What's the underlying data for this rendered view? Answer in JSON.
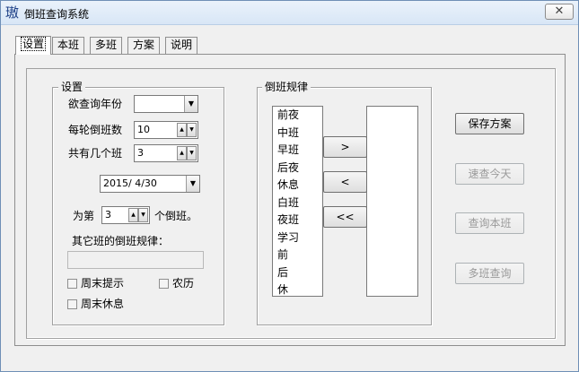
{
  "window": {
    "title": "倒班查询系统",
    "close_glyph": "✕",
    "app_icon_glyph": "璈"
  },
  "tabs": [
    {
      "label": "设置"
    },
    {
      "label": "本班"
    },
    {
      "label": "多班"
    },
    {
      "label": "方案"
    },
    {
      "label": "说明"
    }
  ],
  "settings_group": {
    "title": "设置",
    "year_label": "欲查询年份",
    "year_value": "",
    "rotation_days_label": "每轮倒班数",
    "rotation_days_value": "10",
    "shift_count_label": "共有几个班",
    "shift_count_value": "3",
    "date_value": "2015/ 4/30",
    "which_prefix": "为第",
    "which_value": "3",
    "which_suffix": "个倒班。",
    "other_rule_label": "其它班的倒班规律：",
    "other_rule_value": "",
    "weekend_remind_label": "周末提示",
    "lunar_label": "农历",
    "weekend_rest_label": "周末休息"
  },
  "rules_group": {
    "title": "倒班规律",
    "source_items": [
      "前夜",
      "中班",
      "早班",
      "后夜",
      "休息",
      "白班",
      "夜班",
      "学习",
      "前",
      "后",
      "休"
    ],
    "target_items": [],
    "add_label": ">",
    "remove_label": "<",
    "clear_label": "<<"
  },
  "actions": {
    "save_label": "保存方案",
    "today_label": "速查今天",
    "this_shift_label": "查询本班",
    "multi_label": "多班查询"
  }
}
